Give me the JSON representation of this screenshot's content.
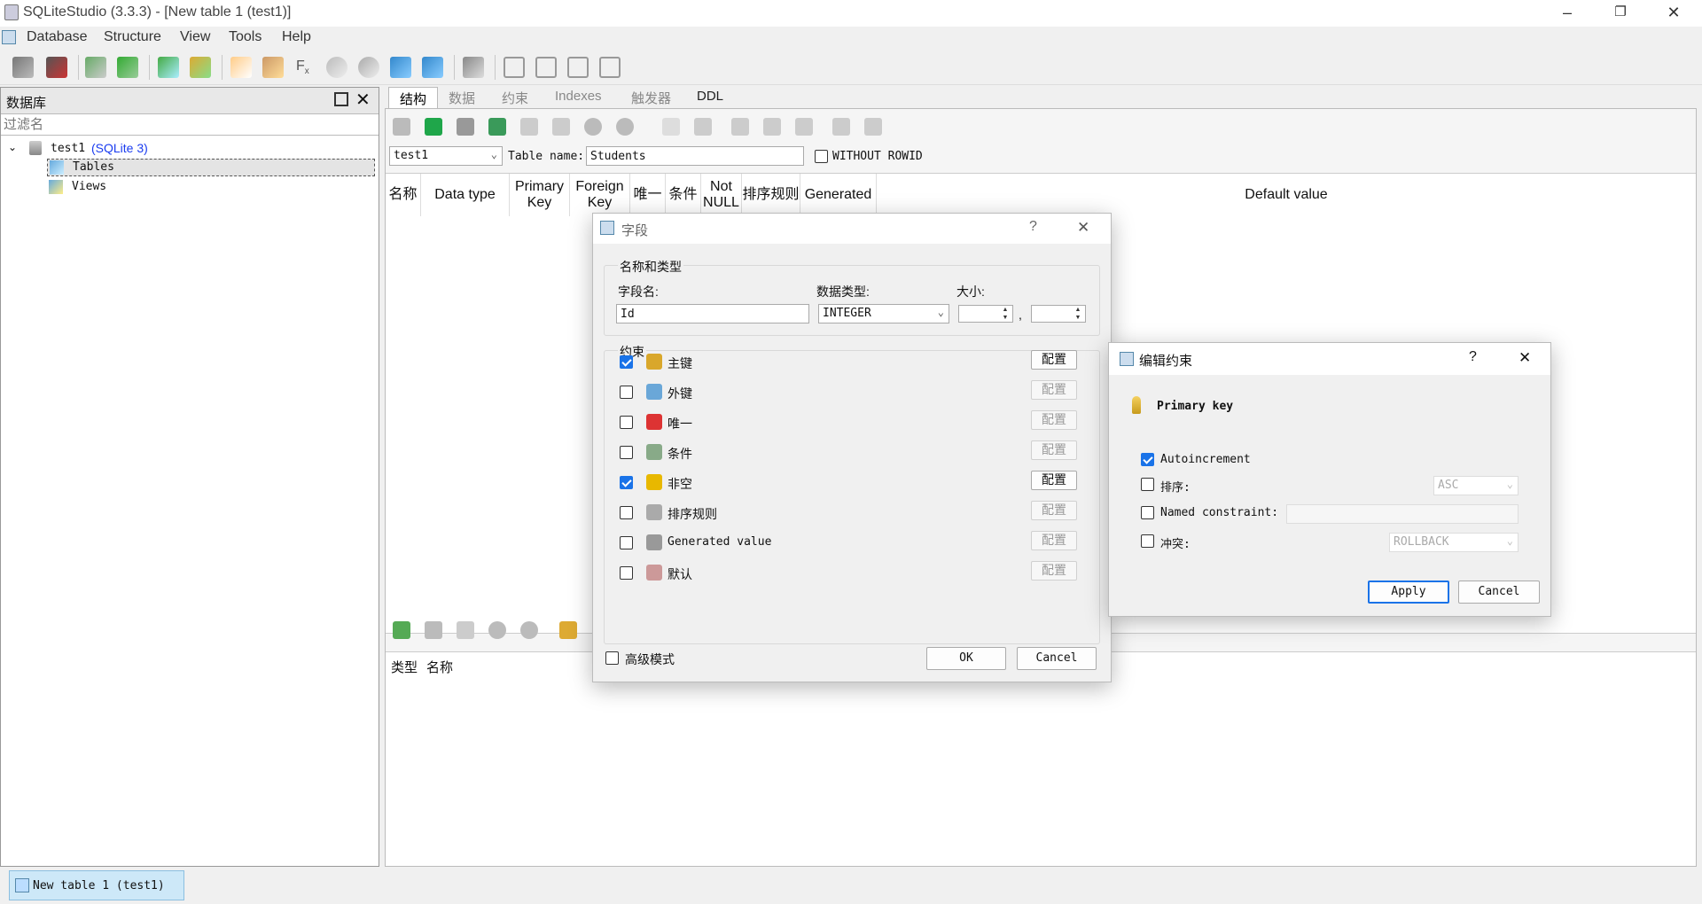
{
  "window": {
    "title": "SQLiteStudio (3.3.3) - [New table 1 (test1)]",
    "minimize": "–",
    "restore": "❐",
    "close": "✕"
  },
  "menu": [
    {
      "label": "Database"
    },
    {
      "label": "Structure"
    },
    {
      "label": "View"
    },
    {
      "label": "Tools"
    },
    {
      "label": "Help"
    }
  ],
  "db_panel": {
    "title": "数据库",
    "filter_placeholder": "过滤名",
    "db_name": "test1",
    "db_type": "(SQLite 3)",
    "tables_label": "Tables",
    "views_label": "Views"
  },
  "tabs": [
    {
      "label": "结构",
      "active": true
    },
    {
      "label": "数据"
    },
    {
      "label": "约束"
    },
    {
      "label": "Indexes"
    },
    {
      "label": "触发器"
    },
    {
      "label": "DDL"
    }
  ],
  "table_editor": {
    "db_select": "test1",
    "table_name_label": "Table name:",
    "table_name_value": "Students",
    "without_rowid_label": "WITHOUT ROWID",
    "columns": [
      "名称",
      "Data type",
      "Primary Key",
      "Foreign Key",
      "唯一",
      "条件",
      "Not NULL",
      "排序规则",
      "Generated",
      "Default value"
    ],
    "constraints_headers": [
      "类型",
      "名称"
    ]
  },
  "column_dialog": {
    "title": "字段",
    "help": "?",
    "close": "✕",
    "group_name_type": "名称和类型",
    "field_name_label": "字段名:",
    "field_name_value": "Id",
    "data_type_label": "数据类型:",
    "data_type_value": "INTEGER",
    "size_label": "大小:",
    "size_sep": ",",
    "group_constraints": "约束",
    "constraints": [
      {
        "label": "主键",
        "checked": true,
        "config": "配置",
        "enabled": true
      },
      {
        "label": "外键",
        "checked": false,
        "config": "配置",
        "enabled": false
      },
      {
        "label": "唯一",
        "checked": false,
        "config": "配置",
        "enabled": false
      },
      {
        "label": "条件",
        "checked": false,
        "config": "配置",
        "enabled": false
      },
      {
        "label": "非空",
        "checked": true,
        "config": "配置",
        "enabled": true
      },
      {
        "label": "排序规则",
        "checked": false,
        "config": "配置",
        "enabled": false
      },
      {
        "label": "Generated value",
        "checked": false,
        "config": "配置",
        "enabled": false
      },
      {
        "label": "默认",
        "checked": false,
        "config": "配置",
        "enabled": false
      }
    ],
    "advanced_mode": "高级模式",
    "ok": "OK",
    "cancel": "Cancel"
  },
  "constraint_dialog": {
    "title": "编辑约束",
    "help": "?",
    "close": "✕",
    "heading": "Primary key",
    "autoincrement": "Autoincrement",
    "sort_label": "排序:",
    "sort_value": "ASC",
    "named_constraint_label": "Named constraint:",
    "conflict_label": "冲突:",
    "conflict_value": "ROLLBACK",
    "apply": "Apply",
    "cancel": "Cancel"
  },
  "taskbar": {
    "window_label": "New table 1 (test1)"
  }
}
